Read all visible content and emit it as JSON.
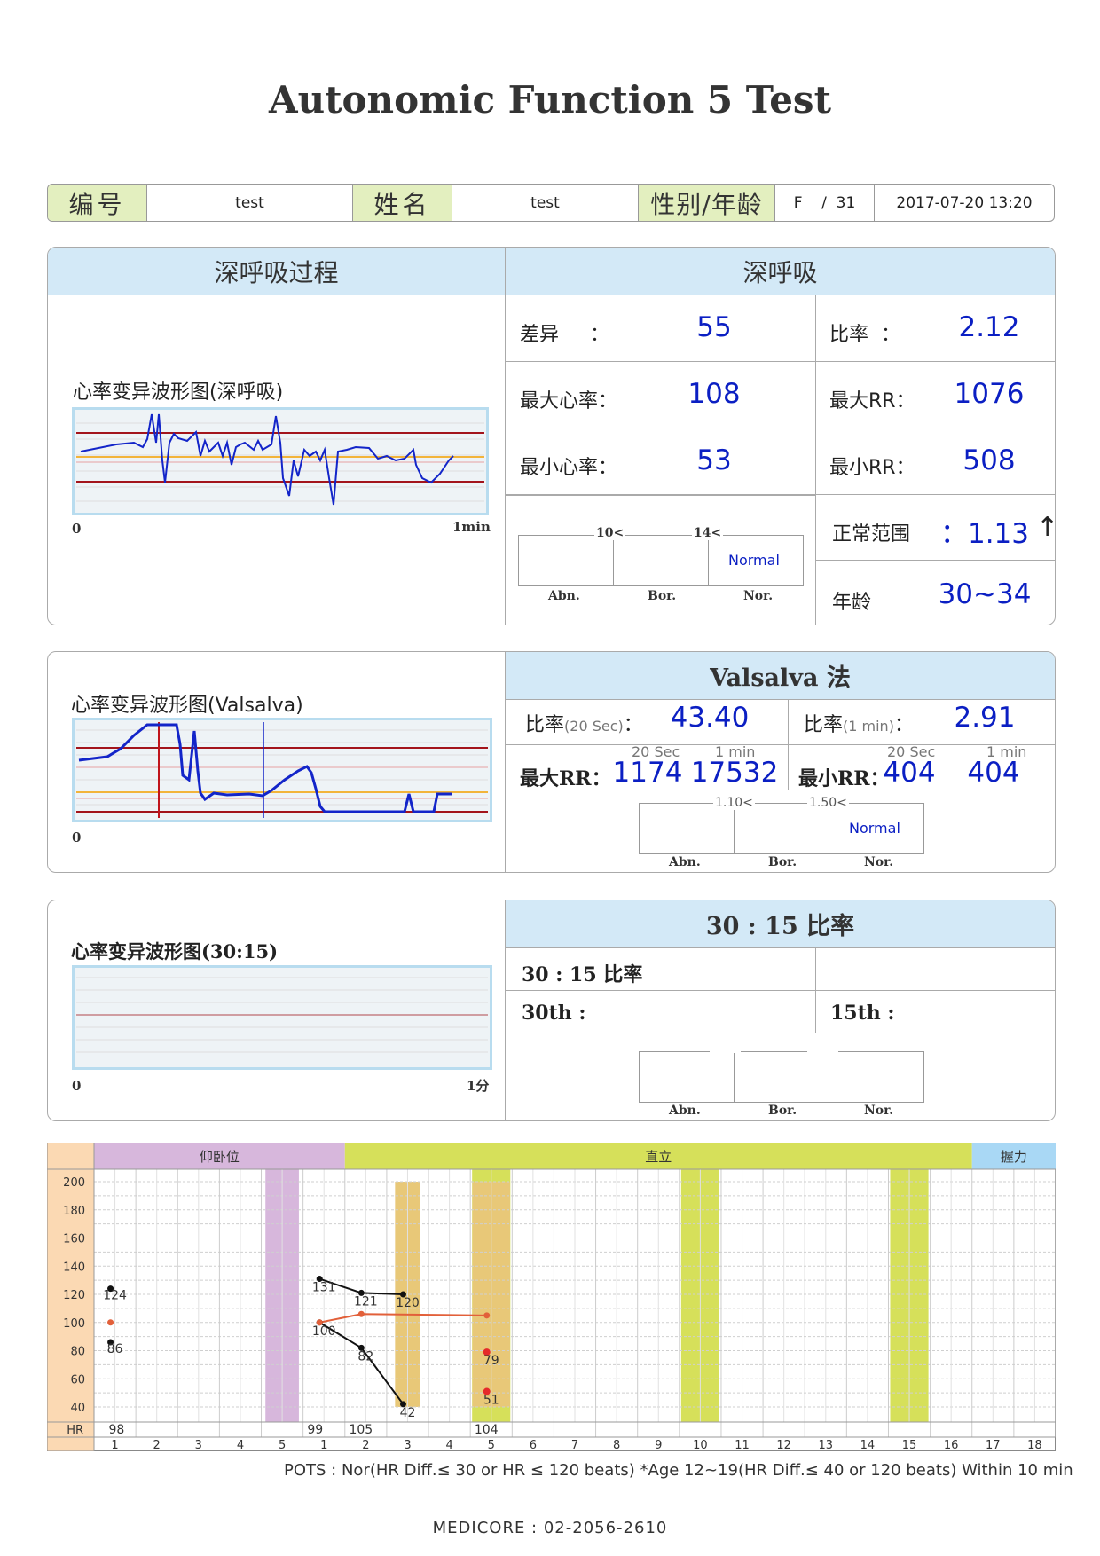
{
  "title": "Autonomic Function 5 Test",
  "header": {
    "id_label": "编号",
    "id_value": "test",
    "name_label": "姓名",
    "name_value": "test",
    "sexage_label": "性别/年龄",
    "sexage_value": "F    /  31",
    "datetime": "2017-07-20 13:20"
  },
  "deep_breath": {
    "left_title": "深呼吸过程",
    "right_title": "深呼吸",
    "wave_label": "心率变异波形图(深呼吸)",
    "axis_start": "0",
    "axis_end": "1min",
    "diff_label": "差异     ：",
    "diff_value": "55",
    "ratio_label": "比率  ：",
    "ratio_value": "2.12",
    "max_hr_label": "最大心率：",
    "max_hr_value": "108",
    "max_rr_label": "最大RR：",
    "max_rr_value": "1076",
    "min_hr_label": "最小心率：",
    "min_hr_value": "53",
    "min_rr_label": "最小RR：",
    "min_rr_value": "508",
    "normal_range_label": "正常范围",
    "normal_range_value": "：1.13",
    "age_label": "年龄",
    "age_value": "30~34",
    "scale": {
      "t1": "10",
      "t2": "14",
      "result": "Normal",
      "abn": "Abn.",
      "bor": "Bor.",
      "nor": "Nor."
    }
  },
  "valsalva": {
    "right_title": "Valsalva 法",
    "wave_label": "心率变异波形图(Valsalva)",
    "axis_start": "0",
    "ratio20_label": "比率",
    "ratio20_sub": "(20 Sec)",
    "ratio20_value": "43.40",
    "ratio1_label": "比率",
    "ratio1_sub": "(1 min)",
    "ratio1_value": "2.91",
    "sub_20sec": "20 Sec",
    "sub_1min": "1 min",
    "max_rr_label": "最大RR：",
    "max_rr_20": "1174",
    "max_rr_1m": "17532",
    "min_rr_label": "最小RR：",
    "min_rr_20": "404",
    "min_rr_1m": "404",
    "scale": {
      "t1": "1.10",
      "t2": "1.50",
      "result": "Normal",
      "abn": "Abn.",
      "bor": "Bor.",
      "nor": "Nor."
    }
  },
  "ratio3015": {
    "right_title": "30 : 15 比率",
    "wave_label": "心率变异波形图(30:15)",
    "axis_start": "0",
    "axis_end": "1分",
    "ratio_label": "30 : 15 比率",
    "th30_label": "30th :",
    "th15_label": "15th :",
    "scale": {
      "abn": "Abn.",
      "bor": "Bor.",
      "nor": "Nor."
    }
  },
  "pots_chart": {
    "phase_supine": "仰卧位",
    "phase_stand": "直立",
    "phase_grip": "握力",
    "y_ticks": [
      "200",
      "180",
      "160",
      "140",
      "120",
      "100",
      "80",
      "60",
      "40"
    ],
    "hr_label": "HR",
    "x_ticks": [
      "1",
      "2",
      "3",
      "4",
      "5",
      "1",
      "2",
      "3",
      "4",
      "5",
      "6",
      "7",
      "8",
      "9",
      "10",
      "11",
      "12",
      "13",
      "14",
      "15",
      "16",
      "17",
      "18"
    ],
    "hr_values": [
      "98",
      "",
      "",
      "",
      "",
      "99",
      "105",
      "",
      "",
      "104"
    ],
    "points": {
      "supine_sys": {
        "x": 1,
        "y": 124,
        "label": "124"
      },
      "supine_dia": {
        "x": 1,
        "y": 86,
        "label": "86"
      },
      "supine_hr": {
        "x": 1,
        "y": 100
      },
      "stand_sys": [
        {
          "x": 6,
          "y": 131,
          "label": "131"
        },
        {
          "x": 7,
          "y": 121,
          "label": "121"
        },
        {
          "x": 8,
          "y": 120,
          "label": "120"
        }
      ],
      "stand_dia": [
        {
          "x": 6,
          "y": 100,
          "label": "100"
        },
        {
          "x": 7,
          "y": 82,
          "label": "82"
        },
        {
          "x": 8,
          "y": 42,
          "label": "42"
        }
      ],
      "stand_hr": [
        {
          "x": 6,
          "y": 100
        },
        {
          "x": 7,
          "y": 106
        },
        {
          "x": 10,
          "y": 105
        }
      ],
      "red_points": [
        {
          "x": 10,
          "y": 79,
          "label": "79"
        },
        {
          "x": 10,
          "y": 51,
          "label": "51"
        }
      ]
    },
    "colors": {
      "supine": "#d7b7dc",
      "stand": "#d6e05a",
      "grip": "#a9d8f5",
      "orange": "#e8c878",
      "axis_bg": "#fbd9b3",
      "hr_line": "#e2603a"
    }
  },
  "pots_note": "POTS : Nor(HR Diff.≤ 30 or HR ≤ 120 beats) *Age 12~19(HR Diff.≤ 40 or 120 beats) Within 10 min",
  "footer": "MEDICORE : 02-2056-2610"
}
